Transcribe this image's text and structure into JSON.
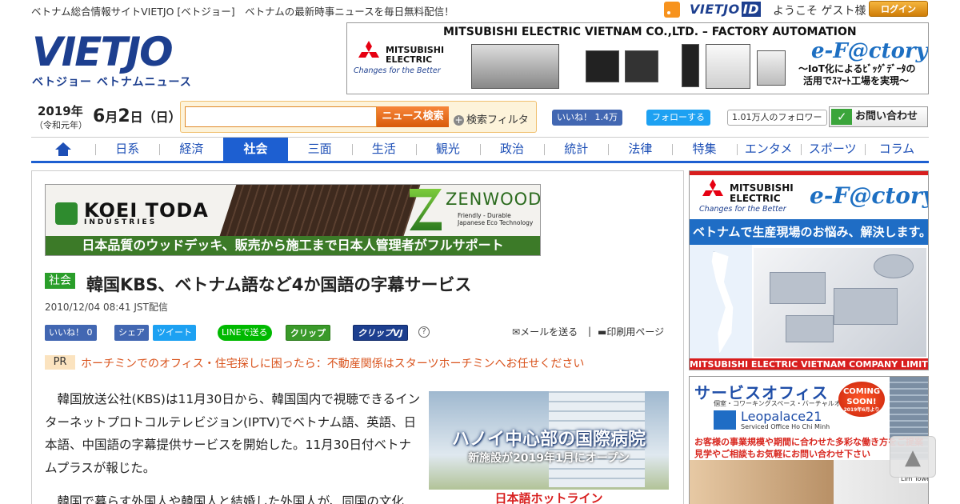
{
  "header": {
    "tagline": "ベトナム総合情報サイトVIETJO [ベトジョー]　ベトナムの最新時事ニュースを毎日無料配信！",
    "vietjo_id_prefix": "VIETJO",
    "vietjo_id_suffix": "ID",
    "welcome": "ようこそ ゲスト様",
    "login_label": "ログイン",
    "logo_main": "VIETJO",
    "logo_sub": "ベトジョー ベトナムニュース"
  },
  "top_banner": {
    "title": "MITSUBISHI ELECTRIC VIETNAM CO.,LTD. – FACTORY AUTOMATION",
    "brand_line1": "MITSUBISHI",
    "brand_line2": "ELECTRIC",
    "brand_tagline": "Changes for the Better",
    "efactory": "e-F@ctory",
    "efactory_desc1": "～IoT化によるﾋﾞｯｸﾞﾃﾞｰﾀの",
    "efactory_desc2": "活用でｽﾏｰﾄ工場を実現～"
  },
  "date": {
    "year": "2019年",
    "era": "（令和元年）",
    "month": "6",
    "month_unit": "月",
    "day": "2",
    "day_unit": "日",
    "weekday": "（日）"
  },
  "search": {
    "placeholder": "",
    "button_label": "ニュース検索",
    "filter_label": "検索フィルタ"
  },
  "social": {
    "fb_like": "いいね！ 1.4万",
    "tw_follow": "フォローする",
    "tw_count": "1.01万人のフォロワー",
    "contact_label": "お問い合わせ"
  },
  "nav": {
    "items": [
      "日系",
      "経済",
      "社会",
      "三面",
      "生活",
      "観光",
      "政治",
      "統計",
      "法律",
      "特集",
      "エンタメ",
      "スポーツ",
      "コラム"
    ],
    "active": "社会"
  },
  "koei_banner": {
    "name": "KOEI TODA",
    "industries": "INDUSTRIES",
    "zenwood": "ZENWOOD",
    "zen_sub1": "Friendly - Durable",
    "zen_sub2": "Japanese Eco Technology",
    "strip": "日本品質のウッドデッキ、販売から施工まで日本人管理者がフルサポート"
  },
  "article": {
    "category": "社会",
    "title": "韓国KBS、ベトナム語など4か国語の字幕サービス",
    "published": "2010/12/04 08:41 JST配信",
    "share": {
      "fb": "いいね！ 0",
      "share": "シェア",
      "tweet": "ツイート",
      "line": "LINEで送る",
      "clip": "クリップ",
      "clip_vj": "クリップVJ",
      "mail": "メールを送る",
      "print": "印刷用ページ",
      "separator": "|"
    },
    "pr_badge": "PR",
    "pr_text": "ホーチミンでのオフィス・住宅探しに困ったら：不動産関係はスターツホーチミンへお任せください",
    "paragraphs": [
      "韓国放送公社(KBS)は11月30日から、韓国国内で視聴できるインターネットプロトコルテレビジョン(IPTV)でベトナム語、英語、日本語、中国語の字幕提供サービスを開始した。11月30日付ベトナムプラスが報じた。",
      "韓国で暮らす外国人や韓国人と結婚した外国人が、同国の文化"
    ]
  },
  "hospital_banner": {
    "title": "ハノイ中心部の国際病院",
    "subtitle": "新施設が2019年1月にオープン",
    "strip": "日本語ホットライン"
  },
  "side_banner_1": {
    "brand_line1": "MITSUBISHI",
    "brand_line2": "ELECTRIC",
    "brand_tagline": "Changes for the Better",
    "efactory": "e-F@ctory",
    "message": "ベトナムで生産現場のお悩み、解決します。",
    "footer": "MITSUBISHI ELECTRIC VIETNAM COMPANY LIMITED"
  },
  "side_banner_2": {
    "title": "サービスオフィス",
    "sub": "個室・コワーキングスペース・バーチャルオフィス",
    "brand": "Leopalace21",
    "brand_sub": "Serviced Office Ho Chi Minh",
    "soon1": "COMING",
    "soon2": "SOON!",
    "soon3": "2019年6月より",
    "red1": "お客様の事業規模や期間に合わせた多彩な働き方をご提案",
    "red2": "見学やご相談もお気軽にお問い合わせ下さい",
    "lim": "Lim Tower"
  },
  "scroll_top_glyph": "▲"
}
